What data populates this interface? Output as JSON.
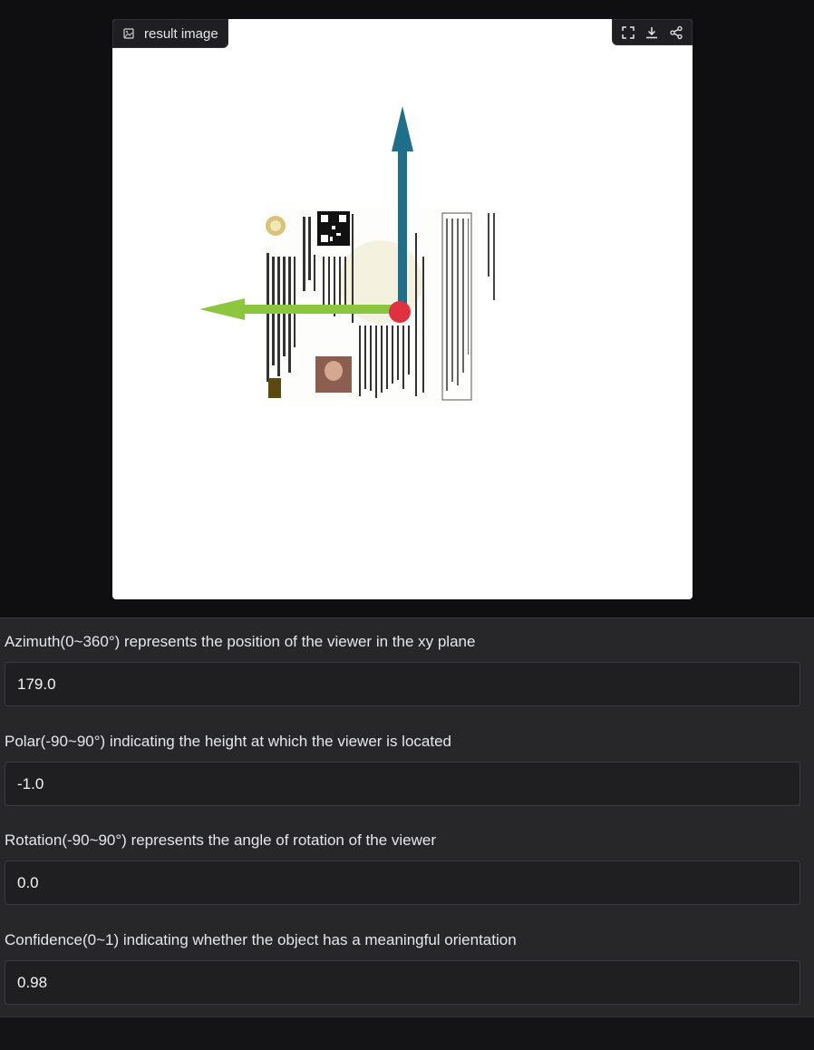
{
  "image_panel": {
    "label": "result image",
    "toolbar": {
      "fullscreen_icon": "fullscreen-icon",
      "download_icon": "download-icon",
      "share_icon": "share-icon"
    },
    "arrow_colors": {
      "vertical": "#1f6f8b",
      "horizontal": "#8cc63f",
      "center": "#e03140"
    }
  },
  "fields": [
    {
      "label": "Azimuth(0~360°) represents the position of the viewer in the xy plane",
      "value": "179.0"
    },
    {
      "label": "Polar(-90~90°) indicating the height at which the viewer is located",
      "value": "-1.0"
    },
    {
      "label": "Rotation(-90~90°) represents the angle of rotation of the viewer",
      "value": "0.0"
    },
    {
      "label": "Confidence(0~1) indicating whether the object has a meaningful orientation",
      "value": "0.98"
    }
  ]
}
